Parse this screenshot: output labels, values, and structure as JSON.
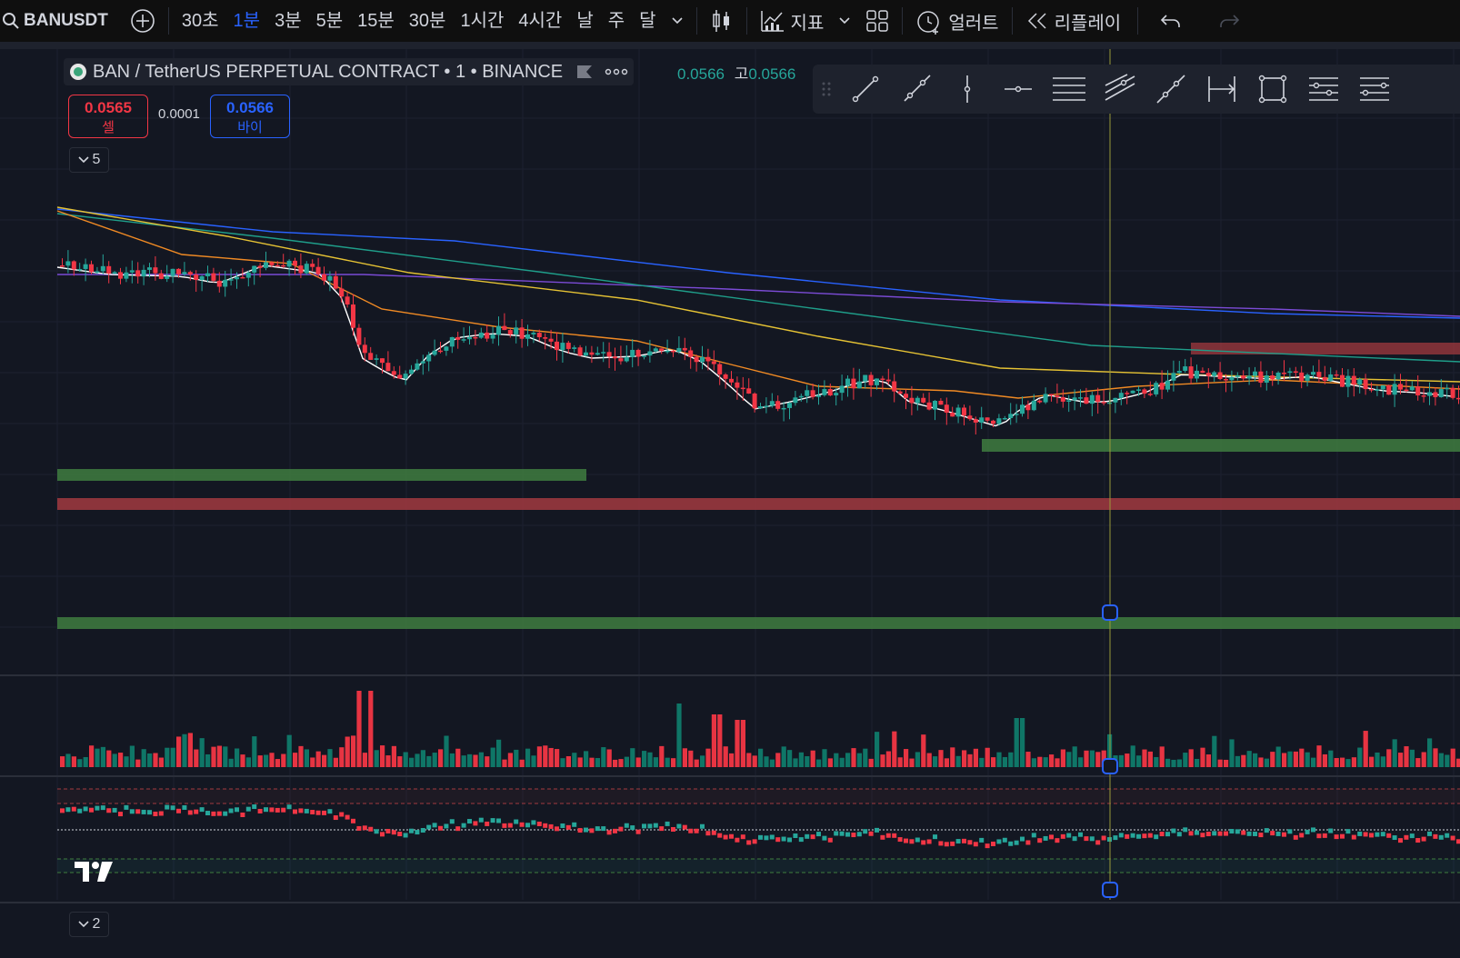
{
  "topbar": {
    "symbol": "BANUSDT",
    "intervals": [
      {
        "label": "30초",
        "active": false
      },
      {
        "label": "1분",
        "active": true
      },
      {
        "label": "3분",
        "active": false
      },
      {
        "label": "5분",
        "active": false
      },
      {
        "label": "15분",
        "active": false
      },
      {
        "label": "30분",
        "active": false
      },
      {
        "label": "1시간",
        "active": false
      },
      {
        "label": "4시간",
        "active": false
      },
      {
        "label": "날",
        "active": false
      },
      {
        "label": "주",
        "active": false
      },
      {
        "label": "달",
        "active": false
      }
    ],
    "indicators_label": "지표",
    "alert_label": "얼러트",
    "replay_label": "리플레이"
  },
  "legend": {
    "title": "BAN / TetherUS PERPETUAL CONTRACT • 1 • BINANCE",
    "ohlc_open": "0.0566",
    "ohlc_high_label": "고",
    "ohlc_high": "0.0566"
  },
  "trade": {
    "sell_price": "0.0565",
    "sell_label": "셀",
    "spread": "0.0001",
    "buy_price": "0.0566",
    "buy_label": "바이"
  },
  "panes": {
    "main_collapse_count": "5",
    "lower_collapse_count": "2"
  },
  "colors": {
    "up": "#26a69a",
    "up_dark": "#0f7b6c",
    "down": "#f23645",
    "background": "#131722",
    "accent": "#2962ff",
    "crosshair": "#9a9a3a"
  },
  "drawing_tools": [
    "drag-handle-icon",
    "trend-line-icon",
    "ray-icon",
    "vertical-line-icon",
    "horizontal-ray-icon",
    "horizontal-lines-icon",
    "parallel-channel-icon",
    "extended-line-icon",
    "date-range-icon",
    "rectangle-icon",
    "fib-retracement-icon",
    "fib-extension-icon"
  ]
}
